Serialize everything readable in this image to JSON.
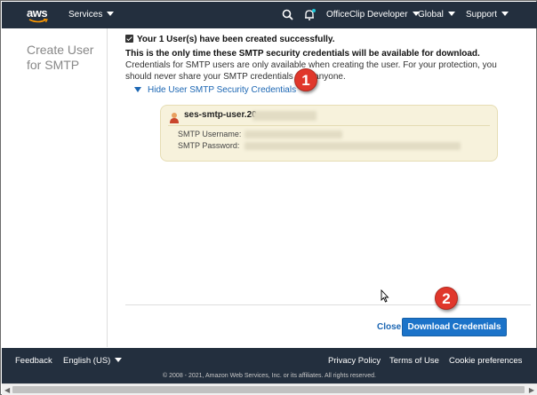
{
  "nav": {
    "logo": "aws",
    "services": "Services",
    "account": "OfficeClip Developer",
    "region": "Global",
    "support": "Support"
  },
  "sidebar": {
    "title": "Create User for SMTP"
  },
  "main": {
    "success": "Your 1 User(s) have been created successfully.",
    "notice_bold": "This is the only time these SMTP security credentials will be available for download.",
    "notice_rest": " Credentials for SMTP users are only available when creating the user. For your protection, you should never share your SMTP credentials with anyone.",
    "toggle_link": "Hide User SMTP Security Credentials",
    "callout_1": "1",
    "callout_2": "2"
  },
  "credentials": {
    "user_name": "ses-smtp-user.20",
    "username_label": "SMTP Username:",
    "password_label": "SMTP Password:"
  },
  "actions": {
    "close": "Close",
    "download": "Download Credentials"
  },
  "footer": {
    "feedback": "Feedback",
    "language": "English (US)",
    "privacy": "Privacy Policy",
    "terms": "Terms of Use",
    "cookies": "Cookie preferences",
    "copyright": "© 2008 - 2021, Amazon Web Services, Inc. or its affiliates. All rights reserved."
  },
  "colors": {
    "nav_bg": "#232f3e",
    "link": "#1b66b3",
    "primary_button": "#1b73c9",
    "callout": "#e0372b",
    "credential_box": "#f7f2dc"
  }
}
